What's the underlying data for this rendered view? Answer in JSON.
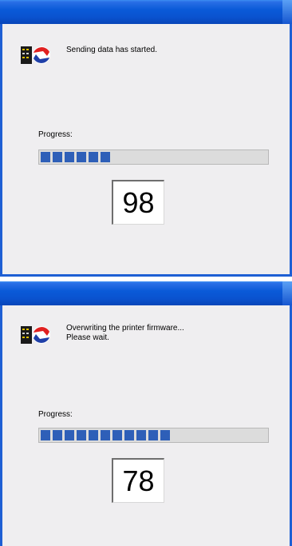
{
  "dialogs": [
    {
      "message": "Sending data has started.",
      "progress_label": "Progress:",
      "progress_fraction": 0.32,
      "progress_segments": 6,
      "counter": "98"
    },
    {
      "message_line1": "Overwriting the printer firmware...",
      "message_line2": "Please wait.",
      "progress_label": "Progress:",
      "progress_fraction": 0.6,
      "progress_segments": 11,
      "counter": "78"
    }
  ],
  "icons": {
    "app": "printer-firmware-update-icon"
  },
  "colors": {
    "titlebar": "#0a5ad8",
    "frame": "#1e5fd4",
    "progress_fill": "#2e5fb8",
    "client_background": "#efeef0"
  }
}
